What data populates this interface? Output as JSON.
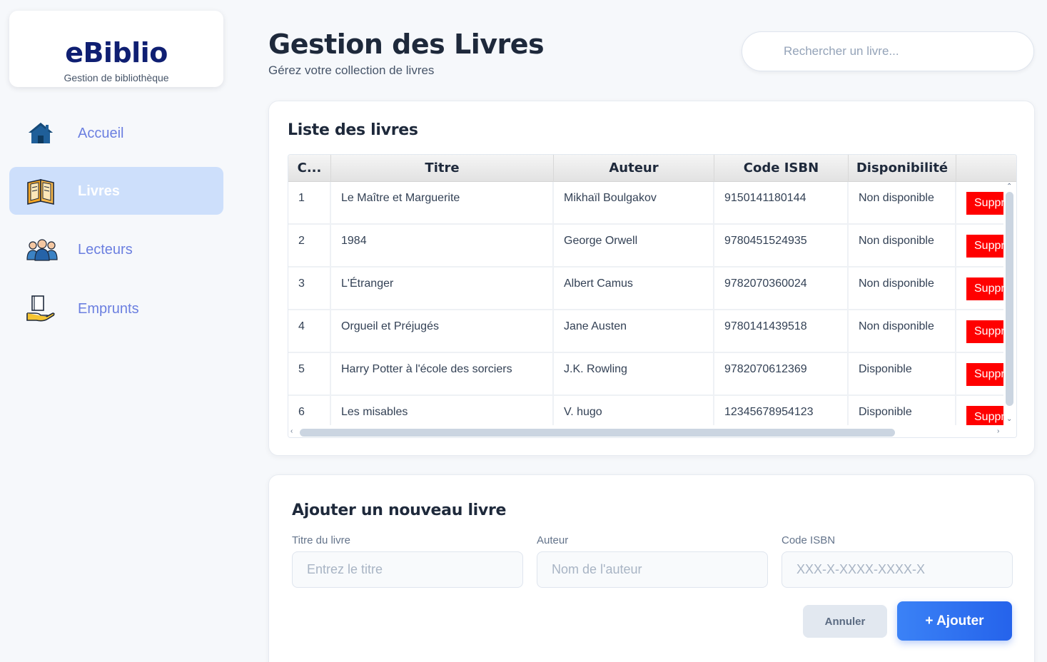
{
  "brand": {
    "name": "eBiblio",
    "tagline": "Gestion de bibliothèque"
  },
  "nav": [
    {
      "label": "Accueil",
      "icon": "home-icon",
      "active": false
    },
    {
      "label": "Livres",
      "icon": "open-book-icon",
      "active": true
    },
    {
      "label": "Lecteurs",
      "icon": "readers-group-icon",
      "active": false
    },
    {
      "label": "Emprunts",
      "icon": "book-in-hand-icon",
      "active": false
    }
  ],
  "header": {
    "title": "Gestion des Livres",
    "subtitle": "Gérez votre collection de livres",
    "search_placeholder": "Rechercher un livre..."
  },
  "list": {
    "title": "Liste des livres",
    "columns": [
      "C...",
      "Titre",
      "Auteur",
      "Code ISBN",
      "Disponibilité"
    ],
    "delete_label": "Supprimer",
    "rows": [
      {
        "id": "1",
        "titre": "Le Maître et Marguerite",
        "auteur": "Mikhaïl Boulgakov",
        "isbn": "9150141180144",
        "dispo": "Non disponible"
      },
      {
        "id": "2",
        "titre": "1984",
        "auteur": "George Orwell",
        "isbn": "9780451524935",
        "dispo": "Non disponible"
      },
      {
        "id": "3",
        "titre": "L'Étranger",
        "auteur": "Albert Camus",
        "isbn": "9782070360024",
        "dispo": "Non disponible"
      },
      {
        "id": "4",
        "titre": "Orgueil et Préjugés",
        "auteur": "Jane Austen",
        "isbn": "9780141439518",
        "dispo": "Non disponible"
      },
      {
        "id": "5",
        "titre": "Harry Potter à l'école des sorciers",
        "auteur": "J.K. Rowling",
        "isbn": "9782070612369",
        "dispo": "Disponible"
      },
      {
        "id": "6",
        "titre": "Les misables",
        "auteur": "V. hugo",
        "isbn": "12345678954123",
        "dispo": "Disponible"
      }
    ]
  },
  "form": {
    "title": "Ajouter un nouveau livre",
    "fields": [
      {
        "label": "Titre du livre",
        "placeholder": "Entrez le titre",
        "value": ""
      },
      {
        "label": "Auteur",
        "placeholder": "Nom de l'auteur",
        "value": ""
      },
      {
        "label": "Code ISBN",
        "placeholder": "XXX-X-XXXX-XXXX-X",
        "value": ""
      }
    ],
    "cancel_label": "Annuler",
    "submit_label": "+ Ajouter"
  },
  "colors": {
    "brand": "#0f1f72",
    "nav_active_bg": "#cddffb",
    "nav_text": "#6b7fe0",
    "delete_button": "#ff0000",
    "primary_button": "#2563eb"
  }
}
